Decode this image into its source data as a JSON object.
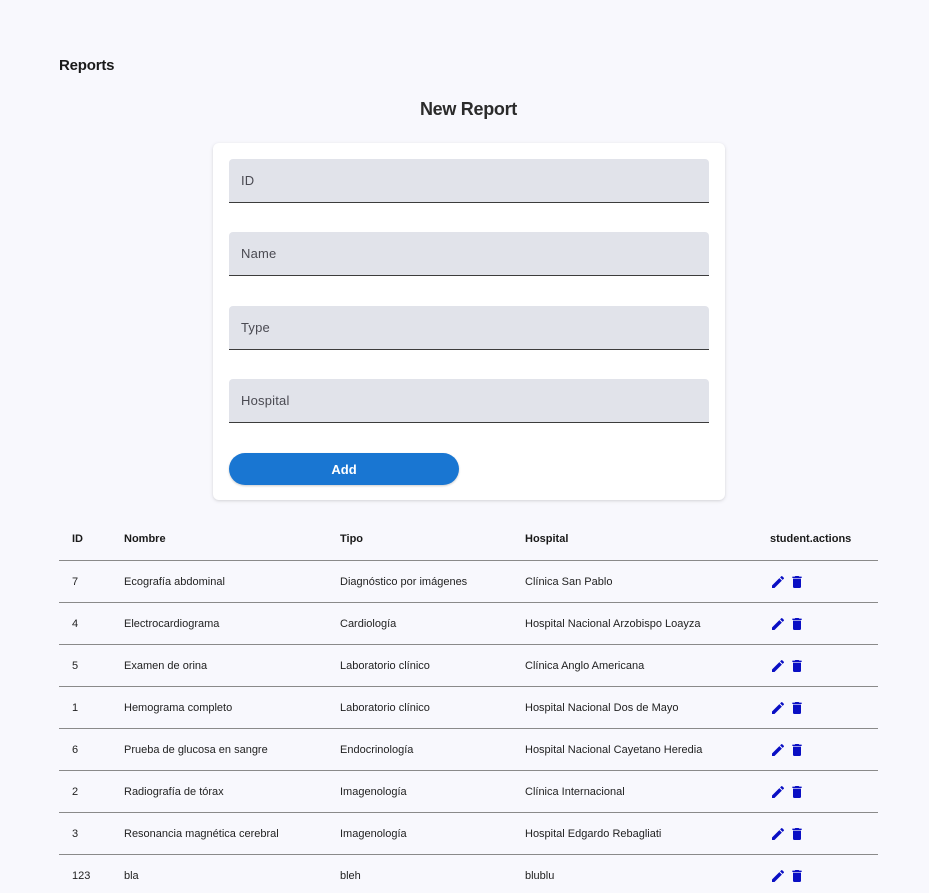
{
  "header": {
    "section_title": "Reports",
    "form_title": "New Report"
  },
  "form": {
    "fields": [
      {
        "placeholder": "ID",
        "value": ""
      },
      {
        "placeholder": "Name",
        "value": ""
      },
      {
        "placeholder": "Type",
        "value": ""
      },
      {
        "placeholder": "Hospital",
        "value": ""
      }
    ],
    "add_label": "Add"
  },
  "colors": {
    "accent": "#1976d2",
    "icon": "#0a0fc4",
    "field_bg": "#e1e3ea",
    "page_bg": "#f8f8fd"
  },
  "table": {
    "headers": [
      "ID",
      "Nombre",
      "Tipo",
      "Hospital",
      "student.actions"
    ],
    "rows": [
      {
        "id": "7",
        "nombre": "Ecografía abdominal",
        "tipo": "Diagnóstico por imágenes",
        "hospital": "Clínica San Pablo"
      },
      {
        "id": "4",
        "nombre": "Electrocardiograma",
        "tipo": "Cardiología",
        "hospital": "Hospital Nacional Arzobispo Loayza"
      },
      {
        "id": "5",
        "nombre": "Examen de orina",
        "tipo": "Laboratorio clínico",
        "hospital": "Clínica Anglo Americana"
      },
      {
        "id": "1",
        "nombre": "Hemograma completo",
        "tipo": "Laboratorio clínico",
        "hospital": "Hospital Nacional Dos de Mayo"
      },
      {
        "id": "6",
        "nombre": "Prueba de glucosa en sangre",
        "tipo": "Endocrinología",
        "hospital": "Hospital Nacional Cayetano Heredia"
      },
      {
        "id": "2",
        "nombre": "Radiografía de tórax",
        "tipo": "Imagenología",
        "hospital": "Clínica Internacional"
      },
      {
        "id": "3",
        "nombre": "Resonancia magnética cerebral",
        "tipo": "Imagenología",
        "hospital": "Hospital Edgardo Rebagliati"
      },
      {
        "id": "123",
        "nombre": "bla",
        "tipo": "bleh",
        "hospital": "blublu"
      }
    ],
    "row_actions": [
      "edit-icon",
      "delete-icon"
    ]
  }
}
